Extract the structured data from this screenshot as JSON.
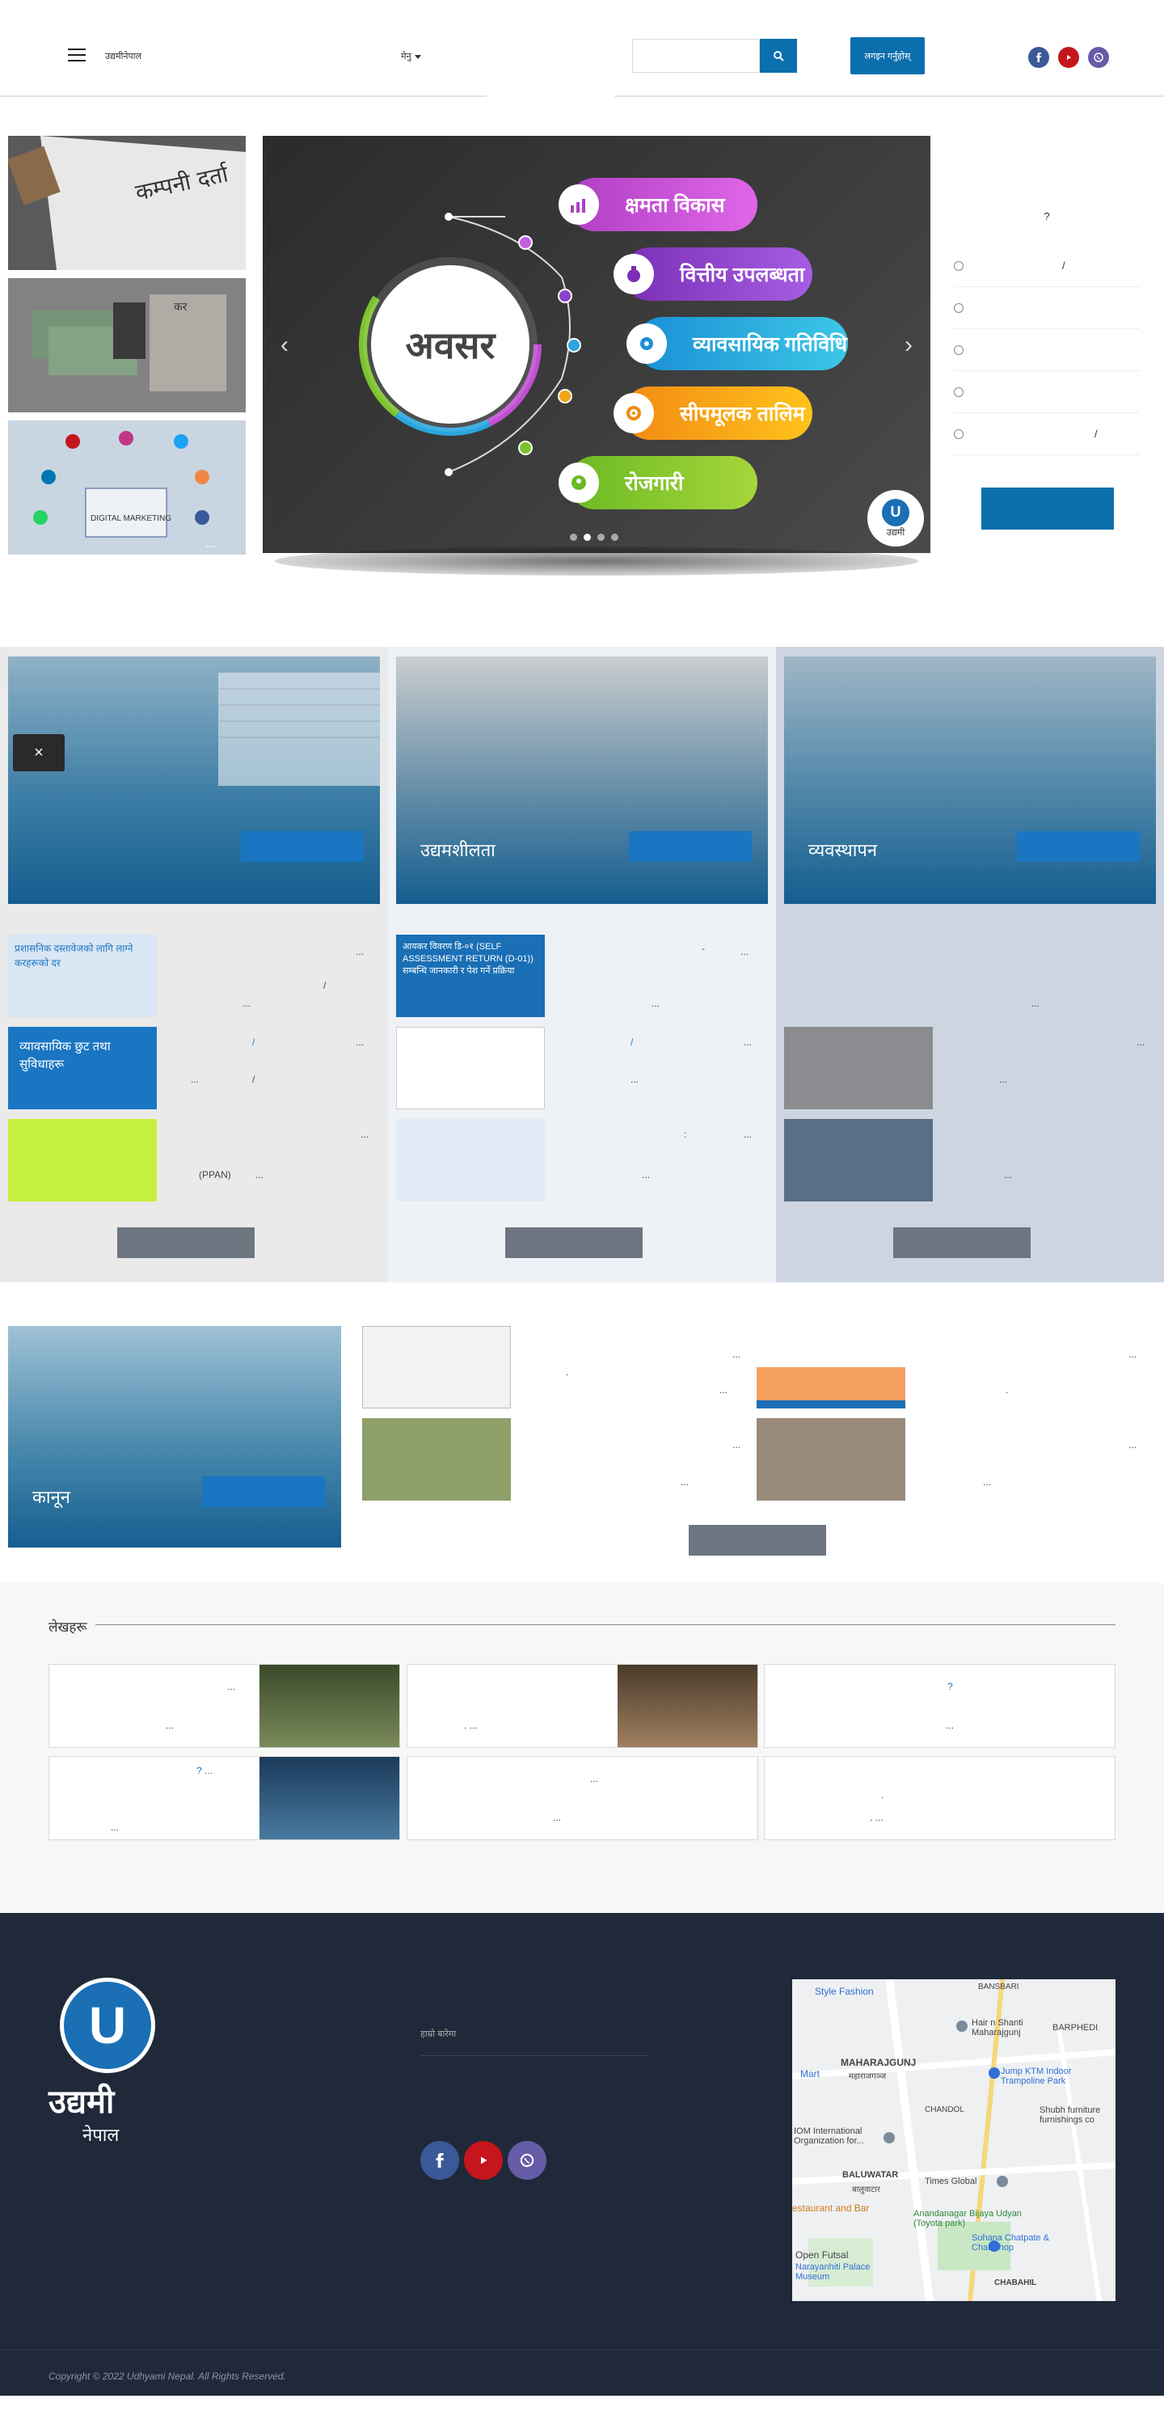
{
  "header": {
    "brand": "उद्यमीनेपाल",
    "menu_label": "मेनु",
    "login_label": "लगइन गर्नुहोस्",
    "icons": {
      "menu": "hamburger-icon",
      "search": "search-icon",
      "facebook": "facebook-icon",
      "youtube": "youtube-icon",
      "viber": "viber-icon"
    }
  },
  "hero": {
    "thumbnails": [
      {
        "text": "कम्पनी दर्ता",
        "label": ""
      },
      {
        "text": "कर",
        "label": ""
      },
      {
        "text": "DIGITAL MARKETING",
        "label": "..."
      }
    ],
    "slider": {
      "center_word": "अवसर",
      "items": [
        "क्षमता विकास",
        "वित्तीय उपलब्धता",
        "व्यावसायिक गतिविधि",
        "सीपमूलक तालिम",
        "रोजगारी"
      ],
      "logo_text": "उद्यमी",
      "dots": 4,
      "active_dot": 1
    },
    "poll": {
      "question": "?",
      "options": [
        "/",
        "",
        "",
        "",
        "/"
      ]
    }
  },
  "categories": {
    "close_label": "×",
    "columns": [
      {
        "title": "",
        "items": [
          {
            "img_text": "प्रशासनिक दस्तावेजको लागि लाग्ने करहरूको दर"
          },
          {
            "img_text": "व्यावसायिक छुट तथा सुविधाहरू"
          },
          {
            "img_text": ""
          }
        ],
        "texts": [
          "...",
          "/",
          "...",
          "/",
          "...",
          "...",
          "/",
          "...",
          "...",
          "(PPAN)",
          "..."
        ]
      },
      {
        "title": "उद्यमशीलता",
        "items": [
          {
            "img_text": "आयकर विवरण डि-०१ (SELF ASSESSMENT RETURN (D-01)) सम्बन्धि जानकारी र पेश गर्ने प्रक्रिया"
          },
          {
            "img_text": ""
          },
          {
            "img_text": ""
          }
        ],
        "texts": [
          "-",
          "...",
          "...",
          "/",
          "...",
          "...",
          ":",
          "...",
          "..."
        ]
      },
      {
        "title": "व्यवस्थापन",
        "items": [
          {
            "img_text": ""
          },
          {
            "img_text": ""
          }
        ],
        "texts": [
          "...",
          "...",
          "...",
          "..."
        ]
      }
    ]
  },
  "section3": {
    "title": "कानून",
    "texts": [
      ".",
      "...",
      "...",
      "...",
      "...",
      "...",
      ".",
      "...",
      "...",
      "...",
      "...",
      "..."
    ]
  },
  "blog": {
    "title": "लेखहरू",
    "cards": [
      {
        "top": "...",
        "bottom": "..."
      },
      {
        "top": "",
        "bottom": ". ..."
      },
      {
        "top": "?",
        "bottom": "..."
      },
      {
        "top": "? ...",
        "bottom": "..."
      },
      {
        "top": "...",
        "bottom": "..."
      },
      {
        "top": ".",
        "bottom": ". ..."
      }
    ]
  },
  "footer": {
    "logo_u": "U",
    "logo_word": "उद्यमी",
    "logo_sub": "नेपाल",
    "link_label": "हाम्रो बारेमा",
    "map_labels": [
      "Style Fashion",
      "BANSBARI",
      "Hair n Shanti Maharajgunj",
      "BARPHEDI",
      "Mart",
      "MAHARAJGUNJ",
      "महाराजगञ्ज",
      "Jump KTM Indoor Trampoline Park",
      "CHANDOL",
      "Shubh furniture furnishings co",
      "IOM International Organization for...",
      "BALUWATAR",
      "बालुवाटार",
      "Times Global",
      "estaurant and Bar",
      "Anandanagar Bijaya Udyan (Toyota park)",
      "Suhana Chatpate & Chat Shop",
      "Open Futsal",
      "Narayanhiti Palace Museum",
      "CHABAHIL"
    ],
    "copyright": "Copyright © 2022 Udhyami Nepal. All Rights Reserved."
  }
}
